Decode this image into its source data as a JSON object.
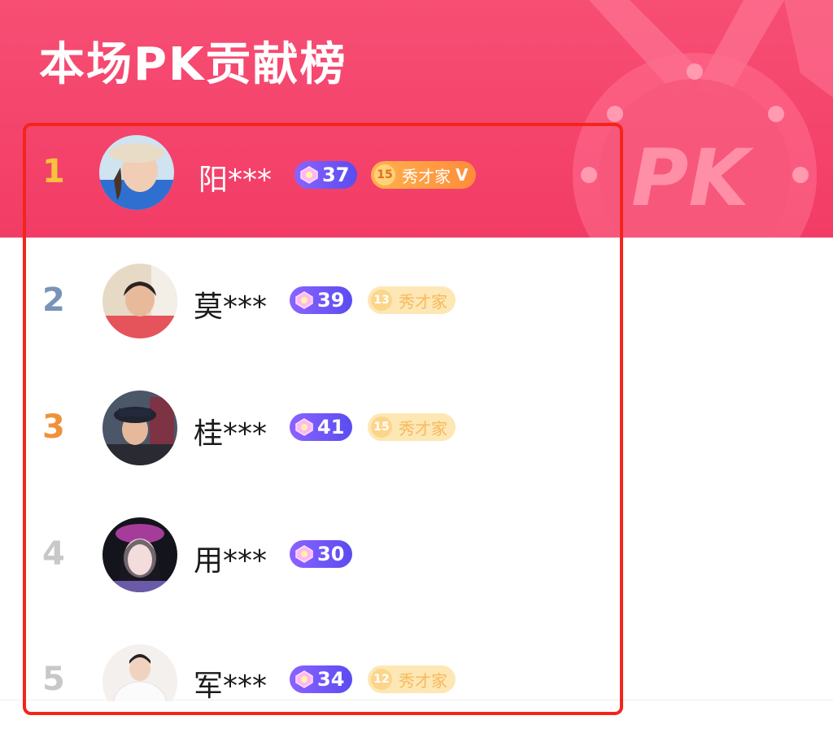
{
  "header": {
    "title": "本场PK贡献榜",
    "badge_text": "PK"
  },
  "colors": {
    "header_bg": "#f23c66",
    "highlight_border": "#f3251b"
  },
  "rows": [
    {
      "rank": "1",
      "rank_color": "#f6c33c",
      "name": "阳***",
      "level": "37",
      "fan_level": "15",
      "fan_label": "秀才家",
      "fan_active": true,
      "verified": "V"
    },
    {
      "rank": "2",
      "rank_color": "#7a93b8",
      "name": "莫***",
      "level": "39",
      "fan_level": "13",
      "fan_label": "秀才家",
      "fan_active": false
    },
    {
      "rank": "3",
      "rank_color": "#f0923a",
      "name": "桂***",
      "level": "41",
      "fan_level": "15",
      "fan_label": "秀才家",
      "fan_active": false
    },
    {
      "rank": "4",
      "rank_color": "#c8c8c8",
      "name": "用***",
      "level": "30"
    },
    {
      "rank": "5",
      "rank_color": "#c8c8c8",
      "name": "军***",
      "level": "34",
      "fan_level": "12",
      "fan_label": "秀才家",
      "fan_active": false
    }
  ]
}
